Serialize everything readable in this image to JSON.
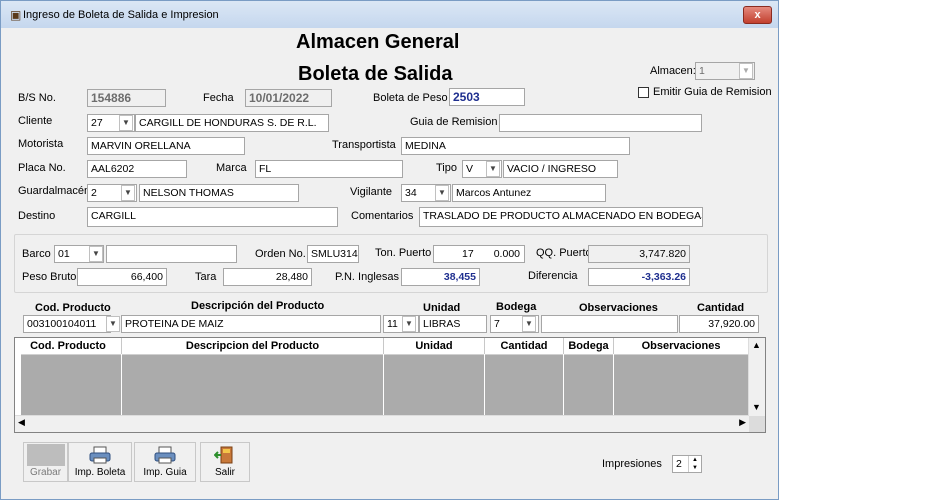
{
  "window": {
    "title": "Ingreso de Boleta de Salida e Impresion",
    "close_label": "x"
  },
  "header": {
    "title1": "Almacen General",
    "title2": "Boleta de Salida"
  },
  "almacen": {
    "label": "Almacen:",
    "value": "1"
  },
  "emitir_guia": {
    "label": "Emitir Guia de Remision",
    "checked": false
  },
  "bs": {
    "label": "B/S No.",
    "value": "154886"
  },
  "fecha": {
    "label": "Fecha",
    "value": "10/01/2022"
  },
  "boleta_peso": {
    "label": "Boleta de Peso",
    "value": "2503"
  },
  "cliente": {
    "label": "Cliente",
    "code": "27",
    "name": "CARGILL DE HONDURAS S. DE R.L."
  },
  "guia_remision": {
    "label": "Guia de Remision",
    "value": ""
  },
  "motorista": {
    "label": "Motorista",
    "value": "MARVIN ORELLANA"
  },
  "transportista": {
    "label": "Transportista",
    "value": "MEDINA"
  },
  "placa": {
    "label": "Placa No.",
    "value": "AAL6202"
  },
  "marca": {
    "label": "Marca",
    "value": "FL"
  },
  "tipo": {
    "label": "Tipo",
    "code": "V",
    "value": "VACIO / INGRESO"
  },
  "guardalmacen": {
    "label": "Guardalmacén",
    "code": "2",
    "name": "NELSON THOMAS"
  },
  "vigilante": {
    "label": "Vigilante",
    "code": "34",
    "name": "Marcos Antunez"
  },
  "destino": {
    "label": "Destino",
    "value": "CARGILL"
  },
  "comentarios": {
    "label": "Comentarios",
    "value": "TRASLADO DE PRODUCTO ALMACENADO EN BODEGAS DE"
  },
  "barco": {
    "label": "Barco",
    "code": "01",
    "name": ""
  },
  "orden": {
    "label": "Orden No.",
    "value": "SMLU314"
  },
  "ton_puerto": {
    "label": "Ton. Puerto",
    "value1": "17",
    "value2": "0.000"
  },
  "qq_puerto": {
    "label": "QQ. Puerto",
    "value": "3,747.820"
  },
  "peso_bruto": {
    "label": "Peso Bruto",
    "value": "66,400"
  },
  "tara": {
    "label": "Tara",
    "value": "28,480"
  },
  "pn_inglesas": {
    "label": "P.N. Inglesas",
    "value": "38,455"
  },
  "diferencia": {
    "label": "Diferencia",
    "value": "-3,363.26"
  },
  "entry": {
    "headers": {
      "cod": "Cod. Producto",
      "desc": "Descripción del Producto",
      "unidad": "Unidad",
      "bodega": "Bodega",
      "obs": "Observaciones",
      "cantidad": "Cantidad"
    },
    "cod": "003100104011",
    "desc": "PROTEINA DE MAIZ",
    "unidad_code": "11",
    "unidad": "LIBRAS",
    "bodega": "7",
    "obs": "",
    "cantidad": "37,920.00"
  },
  "grid": {
    "columns": [
      "Cod. Producto",
      "Descripcion del Producto",
      "Unidad",
      "Cantidad",
      "Bodega",
      "Observaciones"
    ],
    "rows": []
  },
  "toolbar": {
    "grabar": "Grabar",
    "imp_boleta": "Imp. Boleta",
    "imp_guia": "Imp. Guia",
    "salir": "Salir"
  },
  "impresiones": {
    "label": "Impresiones",
    "value": "2"
  },
  "colors": {
    "accent_blue": "#1f2f8f",
    "grid_bg": "#ababab",
    "red_close": "#c2402f"
  }
}
